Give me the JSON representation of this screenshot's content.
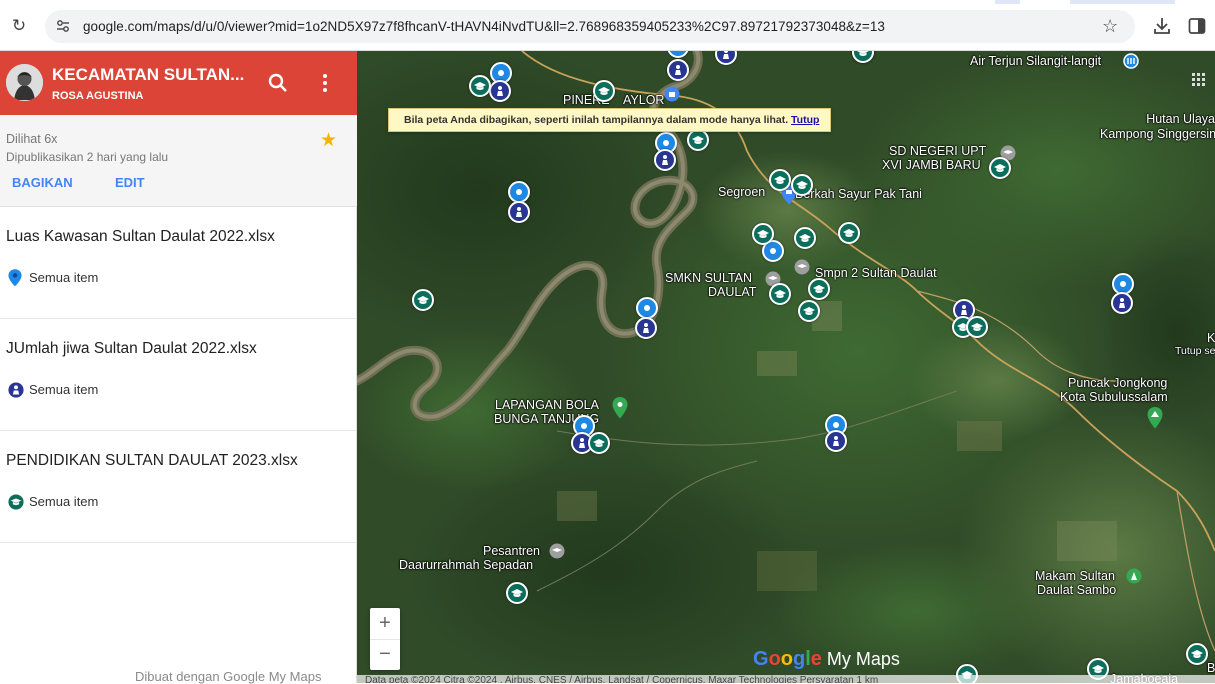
{
  "browser": {
    "url": "google.com/maps/d/u/0/viewer?mid=1o2ND5X97z7f8fhcanV-tHAVN4iNvdTU&ll=2.768968359405233%2C97.89721792373048&z=13"
  },
  "header": {
    "title": "KECAMATAN SULTAN...",
    "author": "ROSA AGUSTINA"
  },
  "info": {
    "views": "Dilihat 6x",
    "published": "Dipublikasikan 2 hari yang lalu",
    "share_label": "BAGIKAN",
    "edit_label": "EDIT"
  },
  "layers": [
    {
      "title": "Luas Kawasan Sultan Daulat 2022.xlsx",
      "item_label": "Semua item",
      "icon": "map-pin-icon",
      "color": "#1e88e5"
    },
    {
      "title": "JUmlah jiwa Sultan Daulat 2022.xlsx",
      "item_label": "Semua item",
      "icon": "person-icon",
      "color": "#283593"
    },
    {
      "title": "PENDIDIKAN SULTAN DAULAT 2023.xlsx",
      "item_label": "Semua item",
      "icon": "graduation-cap-icon",
      "color": "#0b6e5b"
    }
  ],
  "footer": {
    "made_with": "Dibuat dengan Google My Maps"
  },
  "map": {
    "notice_text": "Bila peta Anda dibagikan, seperti inilah tampilannya dalam mode hanya lihat.",
    "notice_close": "Tutup",
    "zoom_in": "+",
    "zoom_out": "−",
    "logo_text": "Google My Maps",
    "attribution": "Data peta ©2024 Citra ©2024 , Airbus, CNES / Airbus, Landsat / Copernicus, Maxar Technologies   Persyaratan   1 km",
    "places": {
      "air_terjun": "Air Terjun Silangit-langit",
      "pinere": "PINERE",
      "taylor": "AYLOR",
      "hutan_1": "Hutan Ulaya",
      "hutan_2": "Kampong Singgersin",
      "sd_negeri_1": "SD NEGERI UPT",
      "sd_negeri_2": "XVI JAMBI BARU",
      "segroen": "Segroen",
      "berkah": "Berkah Sayur Pak Tani",
      "smkn_1": "SMKN SULTAN",
      "smkn_2": "DAULAT",
      "smpn": "Smpn 2 Sultan Daulat",
      "k_edge": "K",
      "tutup_edge": "Tutup se",
      "puncak_1": "Puncak Jongkong",
      "puncak_2": "Kota Subulussalam",
      "lapangan_1": "LAPANGAN BOLA",
      "lapangan_2": "BUNGA TANJUNG",
      "pesantren_1": "Pesantren",
      "pesantren_2": "Daarurrahmah Sepadan",
      "makam_1": "Makam Sultan",
      "makam_2": "Daulat Sambo",
      "jamaboeaja": "Jamaboeaja",
      "b_edge": "B"
    }
  },
  "colors": {
    "header_red": "#db4437",
    "accent_blue": "#4285f4",
    "star_yellow": "#f4b400"
  }
}
